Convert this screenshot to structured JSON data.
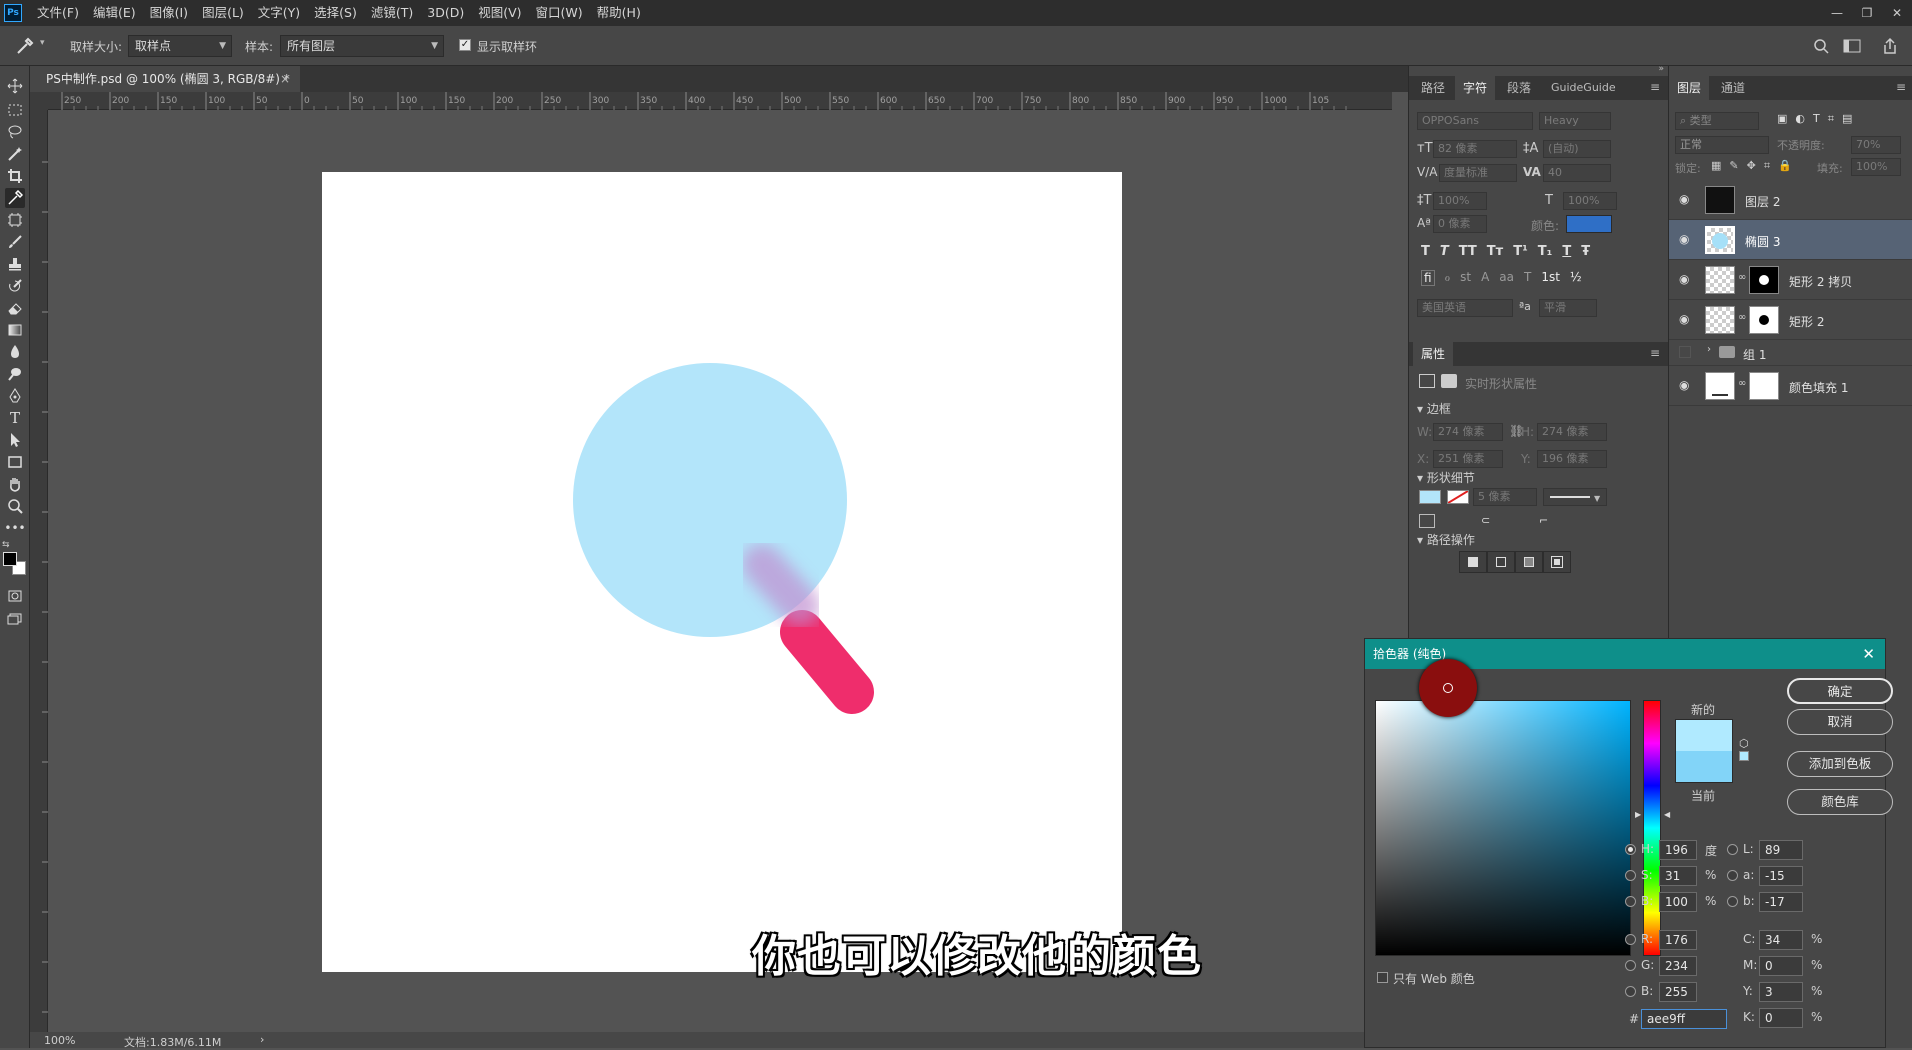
{
  "menubar": {
    "logo": "Ps",
    "items": [
      "文件(F)",
      "编辑(E)",
      "图像(I)",
      "图层(L)",
      "文字(Y)",
      "选择(S)",
      "滤镜(T)",
      "3D(D)",
      "视图(V)",
      "窗口(W)",
      "帮助(H)"
    ]
  },
  "options": {
    "sample_size_label": "取样大小:",
    "sample_size_value": "取样点",
    "sample_label": "样本:",
    "sample_value": "所有图层",
    "show_ring_label": "显示取样环"
  },
  "doc_tab": {
    "title": "PS中制作.psd @ 100% (椭圆 3, RGB/8#) *",
    "close": "×"
  },
  "ruler_marks": [
    "250",
    "200",
    "150",
    "100",
    "50",
    "0",
    "50",
    "100",
    "150",
    "200",
    "250",
    "300",
    "350",
    "400",
    "450",
    "500",
    "550",
    "600",
    "650",
    "700",
    "750",
    "800",
    "850",
    "900",
    "950",
    "1000",
    "105"
  ],
  "subtitle": "你也可以修改他的颜色",
  "status": {
    "zoom": "100%",
    "doc": "文档:1.83M/6.11M"
  },
  "char_panel": {
    "tabs": [
      "路径",
      "字符",
      "段落",
      "GuideGuide"
    ],
    "active_tab": "字符",
    "font_family": "OPPOSans",
    "font_style": "Heavy",
    "size": "82 像素",
    "leading": "(自动)",
    "kerning": "度量标准",
    "tracking": "40",
    "vscale": "100%",
    "hscale": "100%",
    "baseline": "0 像素",
    "color_label": "颜色:",
    "color_hex": "#2f6fc6",
    "style_buttons": [
      "T",
      "T",
      "TT",
      "Tт",
      "T¹",
      "T₁",
      "T",
      "Ŧ"
    ],
    "ot_buttons": [
      "fi",
      "ℴ",
      "st",
      "A",
      "aa",
      "T",
      "1st",
      "½"
    ],
    "language": "美国英语",
    "aa_label": "ªa",
    "aa_value": "平滑"
  },
  "props_panel": {
    "tab": "属性",
    "subtitle": "实时形状属性",
    "bounds_label": "边框",
    "w_label": "W:",
    "w": "274 像素",
    "h_label": "H:",
    "h": "274 像素",
    "x_label": "X:",
    "x": "251 像素",
    "y_label": "Y:",
    "y": "196 像素",
    "shape_detail_label": "形状细节",
    "stroke_width": "5 像素",
    "path_ops_label": "路径操作"
  },
  "layers_panel": {
    "tabs": [
      "图层",
      "通道"
    ],
    "filter_label": "类型",
    "blend_mode": "正常",
    "opacity_label": "不透明度:",
    "opacity": "70%",
    "lock_label": "锁定:",
    "fill_label": "填充:",
    "fill": "100%",
    "layers": [
      {
        "name": "图层 2",
        "visible": true,
        "thumb": "dark",
        "mask": false,
        "selected": false
      },
      {
        "name": "椭圆 3",
        "visible": true,
        "thumb": "shape",
        "mask": false,
        "selected": true
      },
      {
        "name": "矩形 2 拷贝",
        "visible": true,
        "thumb": "checker",
        "mask": true,
        "selected": false
      },
      {
        "name": "矩形 2",
        "visible": true,
        "thumb": "checker",
        "mask": true,
        "selected": false
      },
      {
        "name": "组 1",
        "visible": false,
        "thumb": "folder",
        "mask": false,
        "selected": false
      },
      {
        "name": "颜色填充 1",
        "visible": true,
        "thumb": "white",
        "mask": true,
        "selected": false
      }
    ]
  },
  "color_picker": {
    "title": "拾色器 (纯色)",
    "new_label": "新的",
    "current_label": "当前",
    "new_color": "#b0eaff",
    "current_color": "#82d4f8",
    "ok": "确定",
    "cancel": "取消",
    "add_swatch": "添加到色板",
    "libraries": "颜色库",
    "web_only_label": "只有 Web 颜色",
    "hue_color": "#00b4ff",
    "fields": {
      "H": "196",
      "H_unit": "度",
      "S": "31",
      "S_unit": "%",
      "B": "100",
      "B_unit": "%",
      "R": "176",
      "G": "234",
      "B2": "255",
      "L": "89",
      "a": "-15",
      "b": "-17",
      "C": "34",
      "M": "0",
      "Y": "3",
      "K": "0",
      "pct": "%",
      "hex": "aee9ff"
    }
  },
  "colors": {
    "circle": "#b3e5fa",
    "handle": "#ef2d6c",
    "blur": "#c08fd0"
  }
}
